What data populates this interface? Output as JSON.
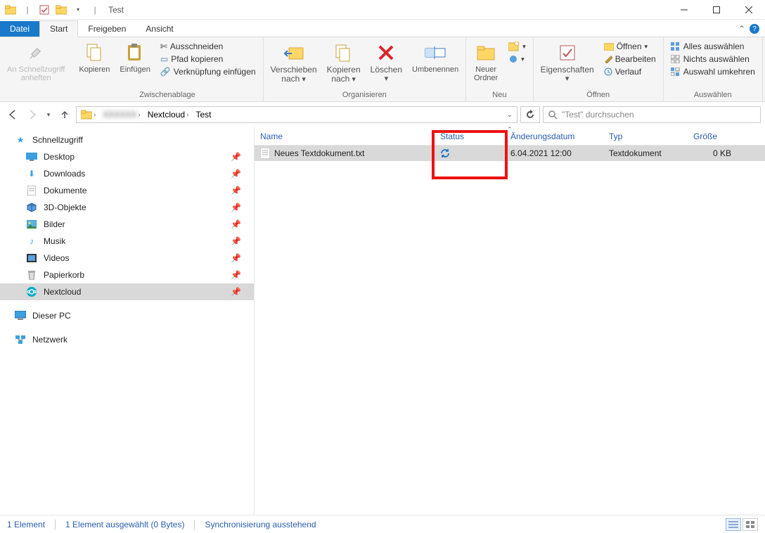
{
  "window": {
    "title": "Test"
  },
  "tabs": {
    "file": "Datei",
    "start": "Start",
    "share": "Freigeben",
    "view": "Ansicht"
  },
  "ribbon": {
    "pin": {
      "label": "An Schnellzugriff\nanheften"
    },
    "copy": "Kopieren",
    "paste": "Einfügen",
    "cut": "Ausschneiden",
    "copypath": "Pfad kopieren",
    "pastelink": "Verknüpfung einfügen",
    "group_clip": "Zwischenablage",
    "moveto": "Verschieben\nnach",
    "copyto": "Kopieren\nnach",
    "delete": "Löschen",
    "rename": "Umbenennen",
    "group_org": "Organisieren",
    "newfolder": "Neuer\nOrdner",
    "group_new": "Neu",
    "properties": "Eigenschaften",
    "open": "Öffnen",
    "edit": "Bearbeiten",
    "history": "Verlauf",
    "group_open": "Öffnen",
    "selectall": "Alles auswählen",
    "selectnone": "Nichts auswählen",
    "invertsel": "Auswahl umkehren",
    "group_sel": "Auswählen"
  },
  "breadcrumb": {
    "seg1": "Nextcloud",
    "seg2": "Test"
  },
  "search": {
    "placeholder": "\"Test\" durchsuchen"
  },
  "nav": {
    "quick": "Schnellzugriff",
    "desktop": "Desktop",
    "downloads": "Downloads",
    "documents": "Dokumente",
    "objects3d": "3D-Objekte",
    "pictures": "Bilder",
    "music": "Musik",
    "videos": "Videos",
    "trash": "Papierkorb",
    "nextcloud": "Nextcloud",
    "thispc": "Dieser PC",
    "network": "Netzwerk"
  },
  "columns": {
    "name": "Name",
    "status": "Status",
    "date": "Änderungsdatum",
    "type": "Typ",
    "size": "Größe"
  },
  "file": {
    "name": "Neues Textdokument.txt",
    "date": "6.04.2021 12:00",
    "type": "Textdokument",
    "size": "0 KB"
  },
  "statusbar": {
    "count": "1 Element",
    "selected": "1 Element ausgewählt (0 Bytes)",
    "sync": "Synchronisierung ausstehend"
  }
}
